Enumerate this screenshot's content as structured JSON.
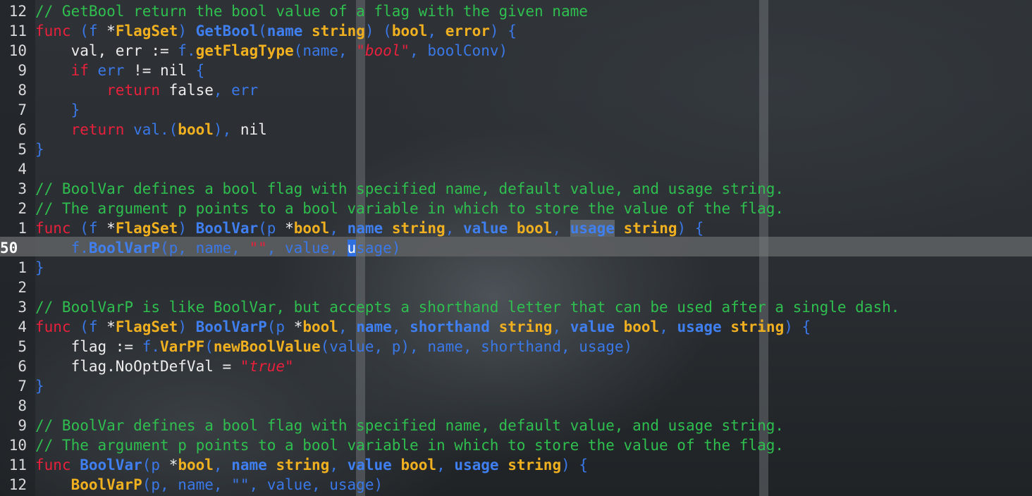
{
  "editor": {
    "colors": {
      "comment": "#2fbf4f",
      "keyword": "#e8203b",
      "type": "#f0b01f",
      "function": "#3f7ff0",
      "plain": "#3a78e8",
      "string": "#e8203b",
      "cursor_line": "#5f6264",
      "cursor": "#2f6fe0"
    },
    "current_line_number": "50",
    "cursor_line_index": 11,
    "lines": [
      {
        "num": "12",
        "tokens": [
          {
            "t": "// GetBool return the bool value of a flag with the given name",
            "c": "c"
          }
        ]
      },
      {
        "num": "11",
        "tokens": [
          {
            "t": "func",
            "c": "k"
          },
          {
            "t": " (f ",
            "c": "p"
          },
          {
            "t": "*",
            "c": "w"
          },
          {
            "t": "FlagSet",
            "c": "t"
          },
          {
            "t": ") ",
            "c": "p"
          },
          {
            "t": "GetBool",
            "c": "f"
          },
          {
            "t": "(",
            "c": "p"
          },
          {
            "t": "name",
            "c": "f"
          },
          {
            "t": " ",
            "c": "p"
          },
          {
            "t": "string",
            "c": "t"
          },
          {
            "t": ") (",
            "c": "p"
          },
          {
            "t": "bool",
            "c": "t"
          },
          {
            "t": ", ",
            "c": "p"
          },
          {
            "t": "error",
            "c": "t"
          },
          {
            "t": ") {",
            "c": "p"
          }
        ]
      },
      {
        "num": "10",
        "tokens": [
          {
            "t": "    val, err := ",
            "c": "w"
          },
          {
            "t": "f.",
            "c": "p"
          },
          {
            "t": "getFlagType",
            "c": "t"
          },
          {
            "t": "(name, ",
            "c": "p"
          },
          {
            "t": "\"bool\"",
            "c": "s"
          },
          {
            "t": ", boolConv)",
            "c": "p"
          }
        ]
      },
      {
        "num": "9",
        "tokens": [
          {
            "t": "    ",
            "c": "w"
          },
          {
            "t": "if",
            "c": "k"
          },
          {
            "t": " err ",
            "c": "p"
          },
          {
            "t": "!= nil ",
            "c": "w"
          },
          {
            "t": "{",
            "c": "p"
          }
        ]
      },
      {
        "num": "8",
        "tokens": [
          {
            "t": "        ",
            "c": "w"
          },
          {
            "t": "return",
            "c": "k"
          },
          {
            "t": " false",
            "c": "w"
          },
          {
            "t": ", err",
            "c": "p"
          }
        ]
      },
      {
        "num": "7",
        "tokens": [
          {
            "t": "    }",
            "c": "p"
          }
        ]
      },
      {
        "num": "6",
        "tokens": [
          {
            "t": "    ",
            "c": "w"
          },
          {
            "t": "return",
            "c": "k"
          },
          {
            "t": " val.(",
            "c": "p"
          },
          {
            "t": "bool",
            "c": "t"
          },
          {
            "t": "), ",
            "c": "p"
          },
          {
            "t": "nil",
            "c": "w"
          }
        ]
      },
      {
        "num": "5",
        "tokens": [
          {
            "t": "}",
            "c": "p"
          }
        ]
      },
      {
        "num": "4",
        "tokens": []
      },
      {
        "num": "3",
        "tokens": [
          {
            "t": "// BoolVar defines a bool flag with specified name, default value, and usage string.",
            "c": "c"
          }
        ]
      },
      {
        "num": "2",
        "tokens": [
          {
            "t": "// The argument p points to a bool variable in which to store the value of the flag.",
            "c": "c"
          }
        ]
      },
      {
        "num": "1",
        "tokens": [
          {
            "t": "func",
            "c": "k"
          },
          {
            "t": " (f ",
            "c": "p"
          },
          {
            "t": "*",
            "c": "w"
          },
          {
            "t": "FlagSet",
            "c": "t"
          },
          {
            "t": ") ",
            "c": "p"
          },
          {
            "t": "BoolVar",
            "c": "f"
          },
          {
            "t": "(p ",
            "c": "p"
          },
          {
            "t": "*",
            "c": "w"
          },
          {
            "t": "bool",
            "c": "t"
          },
          {
            "t": ", ",
            "c": "p"
          },
          {
            "t": "name",
            "c": "f"
          },
          {
            "t": " ",
            "c": "p"
          },
          {
            "t": "string",
            "c": "t"
          },
          {
            "t": ", ",
            "c": "p"
          },
          {
            "t": "value",
            "c": "f"
          },
          {
            "t": " ",
            "c": "p"
          },
          {
            "t": "bool",
            "c": "t"
          },
          {
            "t": ", ",
            "c": "p"
          },
          {
            "t": "usage",
            "c": "f",
            "hl": true
          },
          {
            "t": " ",
            "c": "p"
          },
          {
            "t": "string",
            "c": "t"
          },
          {
            "t": ") {",
            "c": "p"
          }
        ]
      },
      {
        "num": "50",
        "current": true,
        "tokens": [
          {
            "t": "    f.",
            "c": "p"
          },
          {
            "t": "BoolVarP",
            "c": "f"
          },
          {
            "t": "(p, name, ",
            "c": "p"
          },
          {
            "t": "\"\"",
            "c": "s"
          },
          {
            "t": ", value, ",
            "c": "p"
          },
          {
            "t": "u",
            "c": "cur-char"
          },
          {
            "t": "sage)",
            "c": "p"
          }
        ]
      },
      {
        "num": "1",
        "tokens": [
          {
            "t": "}",
            "c": "p"
          }
        ]
      },
      {
        "num": "2",
        "tokens": []
      },
      {
        "num": "3",
        "tokens": [
          {
            "t": "// BoolVarP is like BoolVar, but accepts a shorthand letter that can be used after a single dash.",
            "c": "c"
          }
        ]
      },
      {
        "num": "4",
        "tokens": [
          {
            "t": "func",
            "c": "k"
          },
          {
            "t": " (f ",
            "c": "p"
          },
          {
            "t": "*",
            "c": "w"
          },
          {
            "t": "FlagSet",
            "c": "t"
          },
          {
            "t": ") ",
            "c": "p"
          },
          {
            "t": "BoolVarP",
            "c": "f"
          },
          {
            "t": "(p ",
            "c": "p"
          },
          {
            "t": "*",
            "c": "w"
          },
          {
            "t": "bool",
            "c": "t"
          },
          {
            "t": ", ",
            "c": "p"
          },
          {
            "t": "name",
            "c": "f"
          },
          {
            "t": ", ",
            "c": "p"
          },
          {
            "t": "shorthand",
            "c": "f"
          },
          {
            "t": " ",
            "c": "p"
          },
          {
            "t": "string",
            "c": "t"
          },
          {
            "t": ", ",
            "c": "p"
          },
          {
            "t": "value",
            "c": "f"
          },
          {
            "t": " ",
            "c": "p"
          },
          {
            "t": "bool",
            "c": "t"
          },
          {
            "t": ", ",
            "c": "p"
          },
          {
            "t": "usage",
            "c": "f"
          },
          {
            "t": " ",
            "c": "p"
          },
          {
            "t": "string",
            "c": "t"
          },
          {
            "t": ") {",
            "c": "p"
          }
        ]
      },
      {
        "num": "5",
        "tokens": [
          {
            "t": "    flag := ",
            "c": "w"
          },
          {
            "t": "f.",
            "c": "p"
          },
          {
            "t": "VarPF",
            "c": "t"
          },
          {
            "t": "(",
            "c": "p"
          },
          {
            "t": "newBoolValue",
            "c": "t"
          },
          {
            "t": "(value, p), name, shorthand, usage)",
            "c": "p"
          }
        ]
      },
      {
        "num": "6",
        "tokens": [
          {
            "t": "    flag.NoOptDefVal = ",
            "c": "w"
          },
          {
            "t": "\"true\"",
            "c": "s"
          }
        ]
      },
      {
        "num": "7",
        "tokens": [
          {
            "t": "}",
            "c": "p"
          }
        ]
      },
      {
        "num": "8",
        "tokens": []
      },
      {
        "num": "9",
        "tokens": [
          {
            "t": "// BoolVar defines a bool flag with specified name, default value, and usage string.",
            "c": "c"
          }
        ]
      },
      {
        "num": "10",
        "tokens": [
          {
            "t": "// The argument p points to a bool variable in which to store the value of the flag.",
            "c": "c"
          }
        ]
      },
      {
        "num": "11",
        "tokens": [
          {
            "t": "func",
            "c": "k"
          },
          {
            "t": " ",
            "c": "p"
          },
          {
            "t": "BoolVar",
            "c": "f"
          },
          {
            "t": "(p ",
            "c": "p"
          },
          {
            "t": "*",
            "c": "w"
          },
          {
            "t": "bool",
            "c": "t"
          },
          {
            "t": ", ",
            "c": "p"
          },
          {
            "t": "name",
            "c": "f"
          },
          {
            "t": " ",
            "c": "p"
          },
          {
            "t": "string",
            "c": "t"
          },
          {
            "t": ", ",
            "c": "p"
          },
          {
            "t": "value",
            "c": "f"
          },
          {
            "t": " ",
            "c": "p"
          },
          {
            "t": "bool",
            "c": "t"
          },
          {
            "t": ", ",
            "c": "p"
          },
          {
            "t": "usage",
            "c": "f"
          },
          {
            "t": " ",
            "c": "p"
          },
          {
            "t": "string",
            "c": "t"
          },
          {
            "t": ") {",
            "c": "p"
          }
        ]
      },
      {
        "num": "12",
        "tokens": [
          {
            "t": "    ",
            "c": "p"
          },
          {
            "t": "BoolVarP",
            "c": "t"
          },
          {
            "t": "(p, name, ",
            "c": "p"
          },
          {
            "t": "\"\"",
            "c": "p"
          },
          {
            "t": ", value, usage)",
            "c": "p"
          }
        ]
      }
    ]
  }
}
